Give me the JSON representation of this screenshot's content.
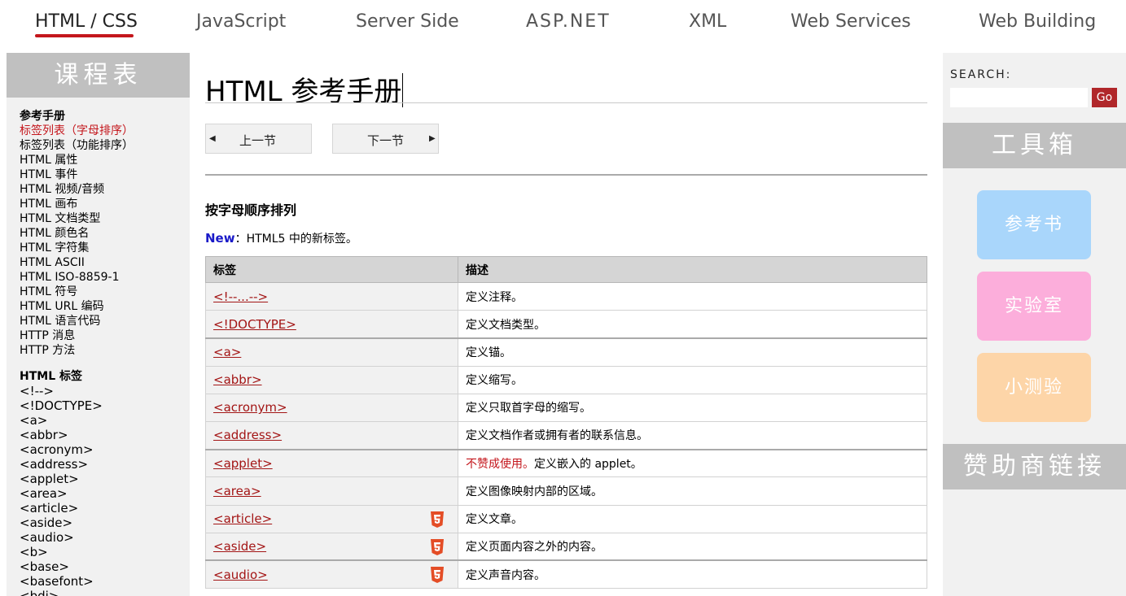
{
  "topnav": {
    "items": [
      "HTML / CSS",
      "JavaScript",
      "Server Side",
      "ASP.NET",
      "XML",
      "Web Services",
      "Web Building"
    ]
  },
  "left_sidebar": {
    "header": "课程表",
    "reference_title": "参考手册",
    "reference_links": [
      "标签列表（字母排序）",
      "标签列表（功能排序）",
      "HTML 属性",
      "HTML 事件",
      "HTML 视频/音频",
      "HTML 画布",
      "HTML 文档类型",
      "HTML 颜色名",
      "HTML 字符集",
      "HTML ASCII",
      "HTML ISO-8859-1",
      "HTML 符号",
      "HTML URL 编码",
      "HTML 语言代码",
      "HTTP 消息",
      "HTTP 方法"
    ],
    "tags_title": "HTML 标签",
    "tag_links": [
      "<!-->",
      "<!DOCTYPE>",
      "<a>",
      "<abbr>",
      "<acronym>",
      "<address>",
      "<applet>",
      "<area>",
      "<article>",
      "<aside>",
      "<audio>",
      "<b>",
      "<base>",
      "<basefont>",
      "<bdi>"
    ]
  },
  "main": {
    "title": "HTML 参考手册",
    "prev_label": "上一节",
    "next_label": "下一节",
    "section_heading": "按字母顺序排列",
    "legend_new": "New",
    "legend_text": "：HTML5 中的新标签。",
    "table": {
      "headers": [
        "标签",
        "描述"
      ],
      "rows": [
        {
          "tag": "<!--...-->",
          "desc": "定义注释。",
          "html5": false,
          "deprecated": ""
        },
        {
          "tag": "<!DOCTYPE>",
          "desc": "定义文档类型。",
          "html5": false,
          "deprecated": ""
        },
        {
          "tag": "<a>",
          "desc": "定义锚。",
          "html5": false,
          "deprecated": ""
        },
        {
          "tag": "<abbr>",
          "desc": "定义缩写。",
          "html5": false,
          "deprecated": ""
        },
        {
          "tag": "<acronym>",
          "desc": "定义只取首字母的缩写。",
          "html5": false,
          "deprecated": ""
        },
        {
          "tag": "<address>",
          "desc": "定义文档作者或拥有者的联系信息。",
          "html5": false,
          "deprecated": ""
        },
        {
          "tag": "<applet>",
          "desc": "定义嵌入的 applet。",
          "html5": false,
          "deprecated": "不赞成使用。"
        },
        {
          "tag": "<area>",
          "desc": "定义图像映射内部的区域。",
          "html5": false,
          "deprecated": ""
        },
        {
          "tag": "<article>",
          "desc": "定义文章。",
          "html5": true,
          "deprecated": ""
        },
        {
          "tag": "<aside>",
          "desc": "定义页面内容之外的内容。",
          "html5": true,
          "deprecated": ""
        },
        {
          "tag": "<audio>",
          "desc": "定义声音内容。",
          "html5": true,
          "deprecated": ""
        }
      ]
    }
  },
  "right_sidebar": {
    "search_label": "SEARCH:",
    "go_label": "Go",
    "toolbox_header": "工具箱",
    "cards": [
      {
        "label": "参考书",
        "color": "#a9d6fb"
      },
      {
        "label": "实验室",
        "color": "#fcaedb"
      },
      {
        "label": "小测验",
        "color": "#fdd5a8"
      }
    ],
    "sponsor_header": "赞助商链接"
  },
  "colors": {
    "accent_red": "#c4161c",
    "link_red": "#a31515",
    "new_blue": "#1a1ac8",
    "html5_orange": "#e44d26"
  }
}
